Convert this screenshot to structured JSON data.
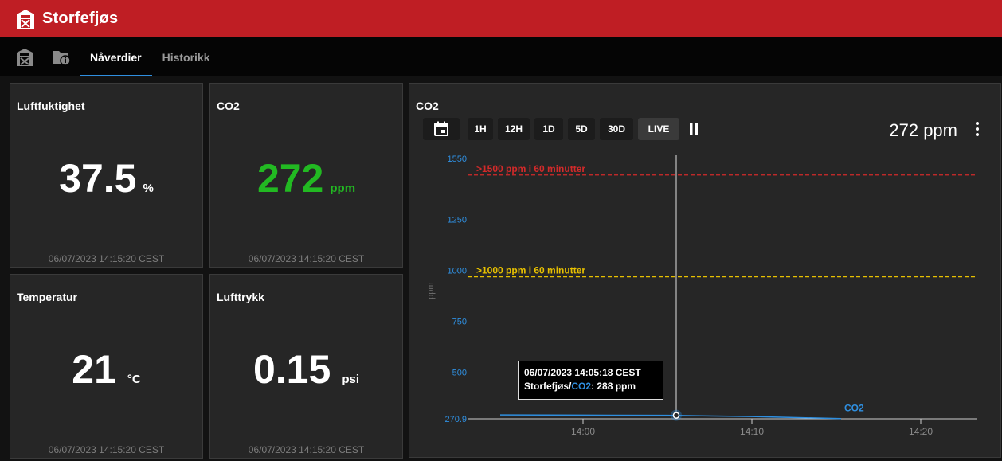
{
  "app": {
    "title": "Storfefjøs",
    "brand_color": "#bf1e24"
  },
  "nav": {
    "icons": [
      "barn-icon",
      "folder-info-icon"
    ],
    "tabs": [
      {
        "label": "Nåverdier",
        "active": true
      },
      {
        "label": "Historikk",
        "active": false
      }
    ],
    "accent": "#2f8fe0"
  },
  "cards": [
    {
      "title": "Luftfuktighet",
      "value": "37.5",
      "unit": "%",
      "timestamp": "06/07/2023 14:15:20 CEST",
      "color": "#ffffff"
    },
    {
      "title": "CO2",
      "value": "272",
      "unit": "ppm",
      "timestamp": "06/07/2023 14:15:20 CEST",
      "color": "#22b922"
    },
    {
      "title": "Temperatur",
      "value": "21",
      "unit": "°C",
      "timestamp": "06/07/2023 14:15:20 CEST",
      "color": "#ffffff"
    },
    {
      "title": "Lufttrykk",
      "value": "0.15",
      "unit": "psi",
      "timestamp": "06/07/2023 14:15:20 CEST",
      "color": "#ffffff"
    }
  ],
  "chart_panel": {
    "title": "CO2",
    "range_buttons": [
      "1H",
      "12H",
      "1D",
      "5D",
      "30D",
      "LIVE"
    ],
    "active_range": "LIVE",
    "current_readout": "272 ppm",
    "tooltip": {
      "time": "06/07/2023 14:05:18 CEST",
      "source": "Storfefjøs/",
      "series": "CO2",
      "value": ": 288 ppm"
    }
  },
  "chart_data": {
    "type": "line",
    "ylabel": "ppm",
    "ylim": [
      270.9,
      1550
    ],
    "y_ticks": [
      "1550",
      "1250",
      "1000",
      "750",
      "500",
      "270.9"
    ],
    "x_ticks": [
      "14:00",
      "14:10",
      "14:20"
    ],
    "series": [
      {
        "name": "CO2",
        "color": "#2f8fe0",
        "x": [
          "13:55",
          "14:00",
          "14:05",
          "14:10",
          "14:15"
        ],
        "values": [
          290,
          289,
          288,
          282,
          272
        ]
      }
    ],
    "thresholds": [
      {
        "label": ">1500 ppm i 60 minutter",
        "value": 1500,
        "color": "#d42a2a"
      },
      {
        "label": ">1000 ppm i 60 minutter",
        "value": 1000,
        "color": "#e7c000"
      }
    ],
    "hover_x": "14:05"
  }
}
